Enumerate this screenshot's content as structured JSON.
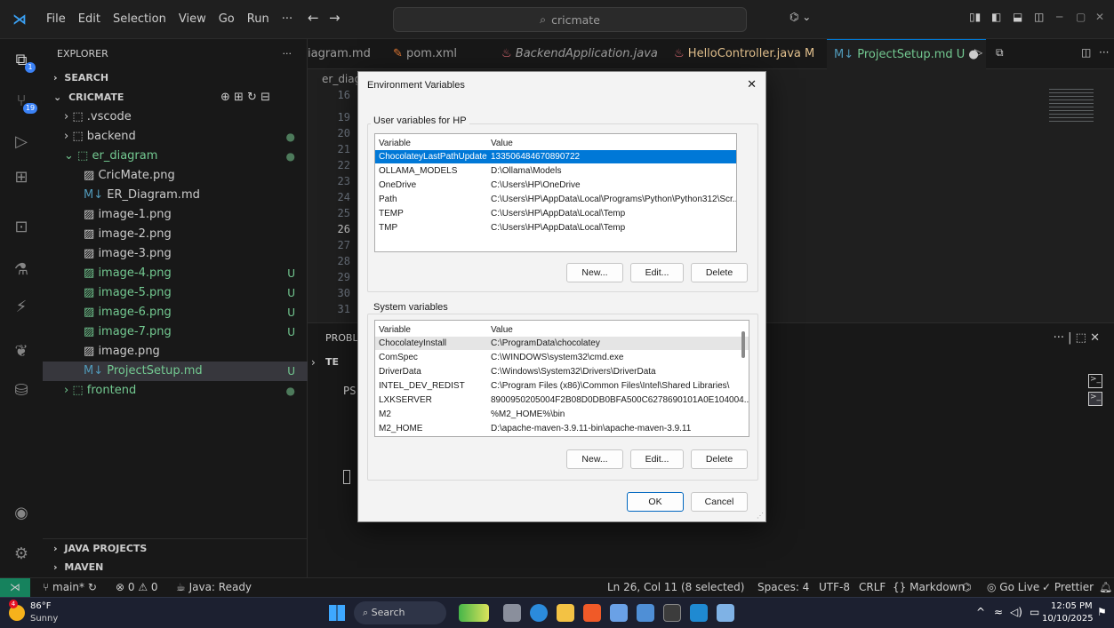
{
  "titlebar": {
    "menu": [
      "File",
      "Edit",
      "Selection",
      "View",
      "Go",
      "Run",
      "···"
    ],
    "search": "cricmate",
    "nav_back": "←",
    "nav_forward": "→"
  },
  "activity": {
    "source_control_badge": "19",
    "accounts_badge": "1"
  },
  "sidebar": {
    "header": "EXPLORER",
    "header_more": "···",
    "search_section": "SEARCH",
    "project": "CRICMATE",
    "items": [
      {
        "label": ".vscode",
        "badge": ""
      },
      {
        "label": "backend",
        "badge": "●"
      },
      {
        "label": "er_diagram",
        "badge": "●"
      },
      {
        "label": "CricMate.png",
        "badge": ""
      },
      {
        "label": "ER_Diagram.md",
        "badge": ""
      },
      {
        "label": "image-1.png",
        "badge": ""
      },
      {
        "label": "image-2.png",
        "badge": ""
      },
      {
        "label": "image-3.png",
        "badge": ""
      },
      {
        "label": "image-4.png",
        "badge": "U"
      },
      {
        "label": "image-5.png",
        "badge": "U"
      },
      {
        "label": "image-6.png",
        "badge": "U"
      },
      {
        "label": "image-7.png",
        "badge": "U"
      },
      {
        "label": "image.png",
        "badge": ""
      },
      {
        "label": "ProjectSetup.md",
        "badge": "U"
      },
      {
        "label": "frontend",
        "badge": "●"
      }
    ],
    "java_projects": "JAVA PROJECTS",
    "maven": "MAVEN"
  },
  "tabs": [
    {
      "label": "iagram.md"
    },
    {
      "label": "pom.xml"
    },
    {
      "label": "BackendApplication.java"
    },
    {
      "label": "HelloController.java M"
    },
    {
      "label": "ProjectSetup.md U"
    }
  ],
  "editor": {
    "breadcrumb": "er_diag",
    "line_numbers": [
      "16",
      "19",
      "20",
      "21",
      "22",
      "23",
      "24",
      "25",
      "26",
      "27",
      "28",
      "29",
      "30",
      "31"
    ]
  },
  "panel": {
    "tab_label": "PROBLE",
    "term_label": "TE",
    "prompt": "PS",
    "actions": "··· | ⬚ ✕"
  },
  "statusbar": {
    "branch": "main*",
    "errors": "⊗ 0 ⚠ 0",
    "java": "Java: Ready",
    "position": "Ln 26, Col 11 (8 selected)",
    "spaces": "Spaces: 4",
    "encoding": "UTF-8",
    "eol": "CRLF",
    "language": "{} Markdown",
    "golive": "Go Live",
    "prettier": "✓ Prettier"
  },
  "taskbar": {
    "weather_temp": "86°F",
    "weather_desc": "Sunny",
    "weather_badge": "4",
    "search": "Search",
    "time": "12:05 PM",
    "date": "10/10/2025"
  },
  "dialog": {
    "title": "Environment Variables",
    "close": "✕",
    "user_group": "User variables for HP",
    "system_group": "System variables",
    "col_variable": "Variable",
    "col_value": "Value",
    "user_vars": [
      {
        "name": "ChocolateyLastPathUpdate",
        "value": "133506484670890722"
      },
      {
        "name": "OLLAMA_MODELS",
        "value": "D:\\Ollama\\Models"
      },
      {
        "name": "OneDrive",
        "value": "C:\\Users\\HP\\OneDrive"
      },
      {
        "name": "Path",
        "value": "C:\\Users\\HP\\AppData\\Local\\Programs\\Python\\Python312\\Scr..."
      },
      {
        "name": "TEMP",
        "value": "C:\\Users\\HP\\AppData\\Local\\Temp"
      },
      {
        "name": "TMP",
        "value": "C:\\Users\\HP\\AppData\\Local\\Temp"
      }
    ],
    "system_vars": [
      {
        "name": "ChocolateyInstall",
        "value": "C:\\ProgramData\\chocolatey"
      },
      {
        "name": "ComSpec",
        "value": "C:\\WINDOWS\\system32\\cmd.exe"
      },
      {
        "name": "DriverData",
        "value": "C:\\Windows\\System32\\Drivers\\DriverData"
      },
      {
        "name": "INTEL_DEV_REDIST",
        "value": "C:\\Program Files (x86)\\Common Files\\Intel\\Shared Libraries\\"
      },
      {
        "name": "LXKSERVER",
        "value": "8900950205004F2B08D0DB0BFA500C6278690101A0E104004..."
      },
      {
        "name": "M2",
        "value": "%M2_HOME%\\bin"
      },
      {
        "name": "M2_HOME",
        "value": "D:\\apache-maven-3.9.11-bin\\apache-maven-3.9.11"
      }
    ],
    "btn_new": "New...",
    "btn_edit": "Edit...",
    "btn_delete": "Delete",
    "btn_ok": "OK",
    "btn_cancel": "Cancel"
  }
}
